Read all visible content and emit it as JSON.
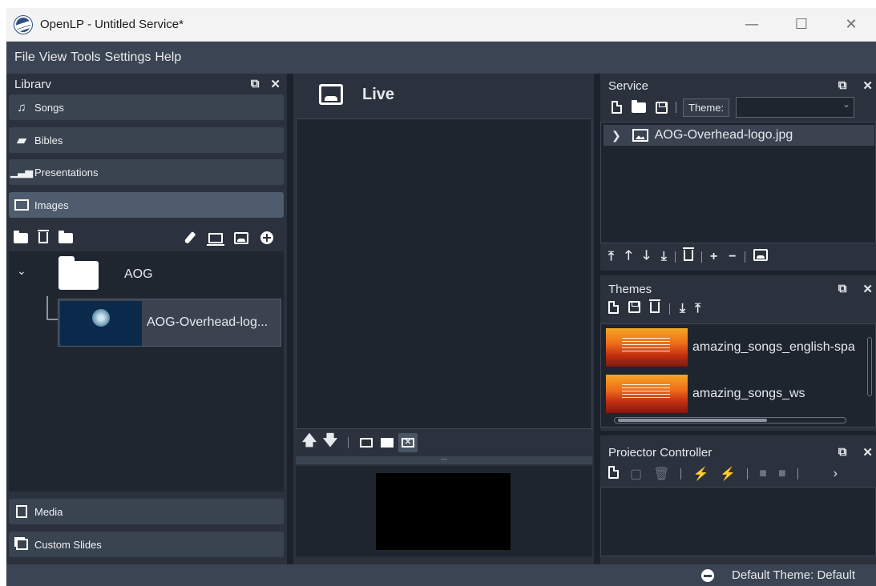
{
  "window": {
    "title": "OpenLP - Untitled Service*",
    "controls": [
      "—",
      "☐",
      "✕"
    ]
  },
  "menu": [
    "File",
    "View",
    "Tools",
    "Settings",
    "Help"
  ],
  "library": {
    "title": "Librarv",
    "tabs": [
      {
        "label": "Songs",
        "icon": "music-note-icon"
      },
      {
        "label": "Bibles",
        "icon": "book-icon"
      },
      {
        "label": "Presentations",
        "icon": "bar-chart-icon"
      },
      {
        "label": "Images",
        "icon": "image-icon",
        "active": true
      },
      {
        "label": "Media",
        "icon": "media-icon"
      },
      {
        "label": "Custom Slides",
        "icon": "custom-slides-icon"
      }
    ],
    "images_tree": {
      "folder": "AOG",
      "item": "AOG-Overhead-log..."
    }
  },
  "live": {
    "title": "Live"
  },
  "service": {
    "title": "Service",
    "theme_label": "Theme:",
    "theme_value": "",
    "items": [
      {
        "label": "AOG-Overhead-logo.jpg"
      }
    ]
  },
  "themes": {
    "title": "Themes",
    "items": [
      {
        "name": "amazing_songs_english-spa"
      },
      {
        "name": "amazing_songs_ws"
      }
    ]
  },
  "projector": {
    "title": "Proiector Controller"
  },
  "status": {
    "text": "Default Theme: Default"
  }
}
